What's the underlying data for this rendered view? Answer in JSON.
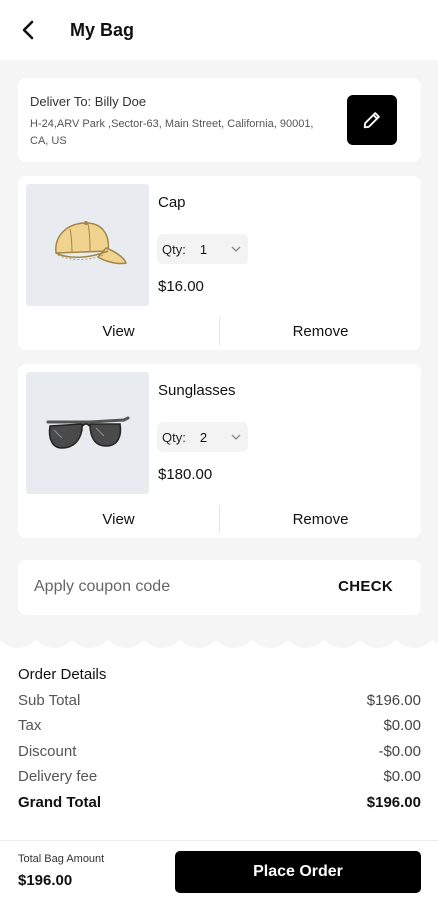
{
  "header": {
    "title": "My Bag",
    "back_icon": "chevron-left-icon"
  },
  "delivery": {
    "label": "Deliver To: Billy Doe",
    "address": "H-24,ARV Park ,Sector-63, Main Street, California, 90001, CA, US",
    "edit_icon": "pencil-icon"
  },
  "items": [
    {
      "name": "Cap",
      "qty_label": "Qty:",
      "qty": "1",
      "price": "$16.00",
      "image": "cap-image",
      "view_label": "View",
      "remove_label": "Remove"
    },
    {
      "name": "Sunglasses",
      "qty_label": "Qty:",
      "qty": "2",
      "price": "$180.00",
      "image": "sunglasses-image",
      "view_label": "View",
      "remove_label": "Remove"
    }
  ],
  "coupon": {
    "placeholder": "Apply coupon code",
    "check_label": "CHECK"
  },
  "order": {
    "title": "Order Details",
    "sub_total": {
      "label": "Sub Total",
      "value": "$196.00"
    },
    "tax": {
      "label": "Tax",
      "value": "$0.00"
    },
    "discount": {
      "label": "Discount",
      "value": "-$0.00"
    },
    "delivery_fee": {
      "label": "Delivery fee",
      "value": "$0.00"
    },
    "grand_total": {
      "label": "Grand Total",
      "value": "$196.00"
    }
  },
  "footer": {
    "total_label": "Total Bag Amount",
    "total_value": "$196.00",
    "place_order_label": "Place Order"
  },
  "colors": {
    "primary": "#000000",
    "background": "#f5f5f5",
    "card": "#ffffff",
    "image_bg": "#e8ebef"
  }
}
